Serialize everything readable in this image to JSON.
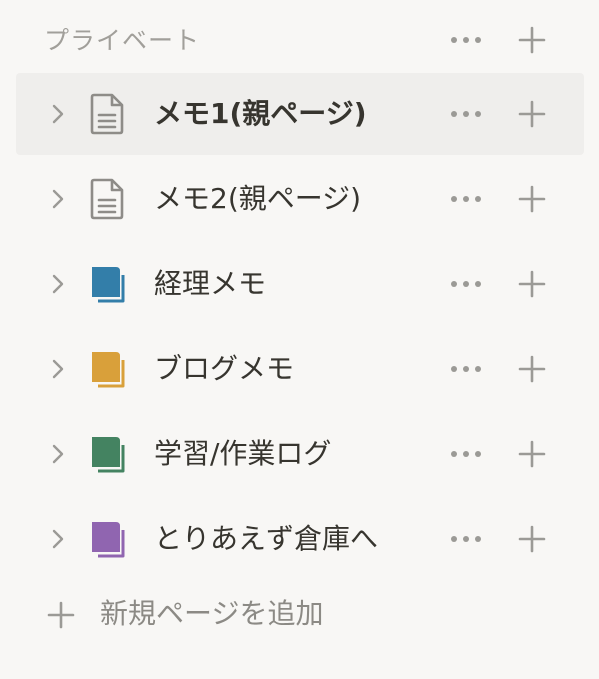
{
  "section": {
    "title": "プライベート"
  },
  "pages": [
    {
      "label": "メモ1(親ページ)",
      "icon": "document-icon",
      "selected": true
    },
    {
      "label": "メモ2(親ページ)",
      "icon": "document-icon",
      "selected": false
    },
    {
      "label": "経理メモ",
      "icon": "notebook-icon",
      "color": "#337ea9",
      "selected": false
    },
    {
      "label": "ブログメモ",
      "icon": "notebook-icon",
      "color": "#d9a03a",
      "selected": false
    },
    {
      "label": "学習/作業ログ",
      "icon": "notebook-icon",
      "color": "#448361",
      "selected": false
    },
    {
      "label": "とりあえず倉庫へ",
      "icon": "notebook-icon",
      "color": "#9065b0",
      "selected": false
    }
  ],
  "new_page": {
    "label": "新規ページを追加"
  },
  "colors": {
    "background": "#f8f7f5",
    "selected_row": "#efeeec",
    "text": "#37352f",
    "muted": "#a19f9a"
  }
}
